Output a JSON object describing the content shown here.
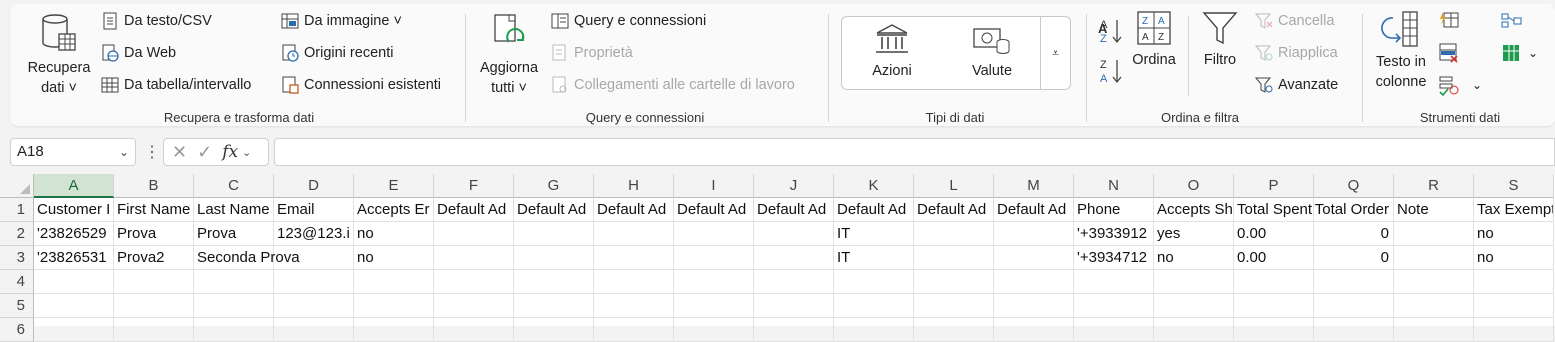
{
  "ribbon": {
    "get_transform": {
      "label": "Recupera e trasforma dati",
      "get_data": [
        "Recupera",
        "dati ˅"
      ],
      "from_text_csv": "Da testo/CSV",
      "from_web": "Da Web",
      "from_table": "Da tabella/intervallo",
      "from_image": "Da immagine ˅",
      "recent_sources": "Origini recenti",
      "existing_connections": "Connessioni esistenti"
    },
    "queries": {
      "label": "Query e connessioni",
      "refresh_all": [
        "Aggiorna",
        "tutti ˅"
      ],
      "queries_connections": "Query e connessioni",
      "properties": "Proprietà",
      "edit_links": "Collegamenti alle cartelle di lavoro"
    },
    "data_types": {
      "label": "Tipi di dati",
      "stocks": "Azioni",
      "currencies": "Valute"
    },
    "sort_filter": {
      "label": "Ordina e filtra",
      "sort": "Ordina",
      "filter": "Filtro",
      "clear": "Cancella",
      "reapply": "Riapplica",
      "advanced": "Avanzate"
    },
    "data_tools": {
      "label": "Strumenti dati",
      "text_to_columns": [
        "Testo in",
        "colonne"
      ]
    }
  },
  "formula_bar": {
    "name_box": "A18",
    "formula": ""
  },
  "sheet": {
    "columns": [
      "A",
      "B",
      "C",
      "D",
      "E",
      "F",
      "G",
      "H",
      "I",
      "J",
      "K",
      "L",
      "M",
      "N",
      "O",
      "P",
      "Q",
      "R",
      "S"
    ],
    "selected_column": "A",
    "rows": [
      "1",
      "2",
      "3",
      "4",
      "5",
      "6"
    ],
    "header_row": [
      "Customer I",
      "First Name",
      "Last Name",
      "Email",
      "Accepts Er",
      "Default Ad",
      "Default Ad",
      "Default Ad",
      "Default Ad",
      "Default Ad",
      "Default Ad",
      "Default Ad",
      "Default Ad",
      "Phone",
      "Accepts Sh",
      "Total Spent",
      "Total Order",
      "Note",
      "Tax Exempt"
    ],
    "row2": {
      "A": "'23826529",
      "B": "Prova",
      "C": "Prova",
      "D": "123@123.i",
      "E": "no",
      "K": "IT",
      "N": "'+3933912",
      "O": "yes",
      "P": "0.00",
      "Q": "0",
      "S": "no"
    },
    "row3": {
      "A": "'23826531",
      "B": "Prova2",
      "C": "Seconda Prova",
      "E": "no",
      "K": "IT",
      "N": "'+3934712",
      "O": "no",
      "P": "0.00",
      "Q": "0",
      "S": "no"
    }
  },
  "colors": {
    "accent": "#1e7145",
    "blue_icon": "#2b6cb0"
  }
}
